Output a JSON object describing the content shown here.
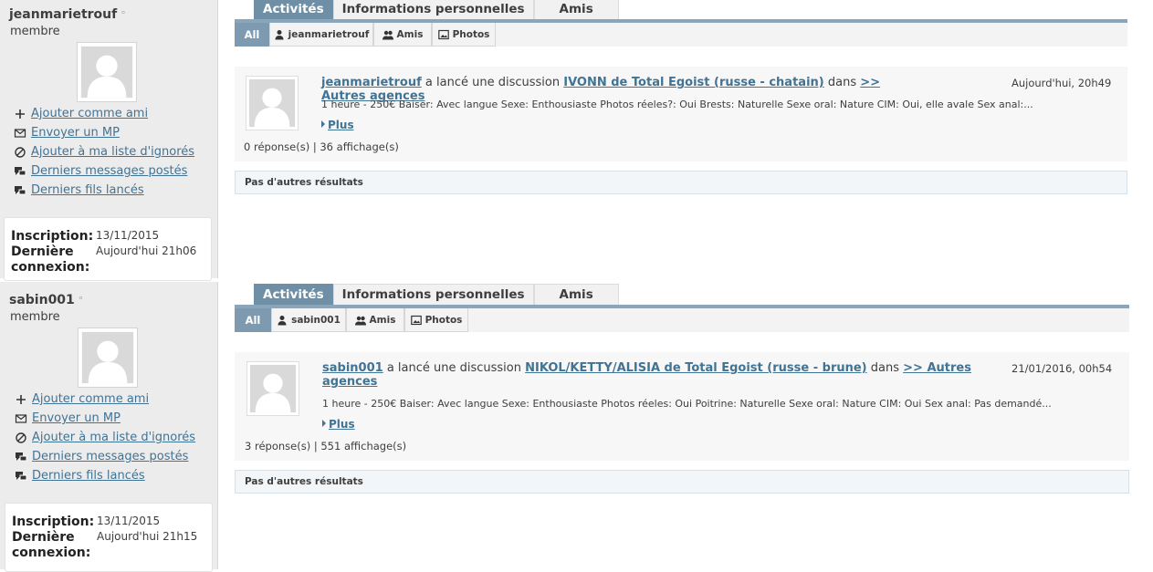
{
  "profiles": [
    {
      "username": "jeanmarietrouf",
      "status_dot": "°",
      "role": "membre",
      "actions": [
        {
          "icon": "plus-icon",
          "label": "Ajouter comme ami"
        },
        {
          "icon": "envelope-icon",
          "label": "Envoyer un MP"
        },
        {
          "icon": "block-icon",
          "label": "Ajouter à ma liste d'ignorés"
        },
        {
          "icon": "chat-bubbles-icon",
          "label": "Derniers messages postés"
        },
        {
          "icon": "chat-bubbles-icon",
          "label": "Derniers fils lancés"
        }
      ],
      "info": {
        "inscription_label": "Inscription:",
        "inscription_value": "13/11/2015",
        "derniere_label": "Dernière",
        "connexion_label": "connexion:",
        "derniere_value": "Aujourd'hui 21h06"
      },
      "tabs": [
        "Activités",
        "Informations personnelles",
        "Amis"
      ],
      "filters": [
        "All",
        "jeanmarietrouf",
        "Amis",
        "Photos"
      ],
      "activity": {
        "author": "jeanmarietrouf",
        "action_text": "a lancé une discussion",
        "thread_title": "IVONN de Total Egoist (russe - chatain)",
        "in_text": "dans",
        "forum": ">> Autres agences",
        "date": "Aujourd'hui, 20h49",
        "snippet": "1 heure - 250€ Baiser: Avec langue Sexe: Enthousiaste Photos réeles?: Oui Brests: Naturelle Sexe oral: Nature CIM: Oui, elle avale Sex anal:...",
        "more_label": "Plus",
        "stats": "0 réponse(s) | 36 affichage(s)"
      },
      "no_more": "Pas d'autres résultats"
    },
    {
      "username": "sabin001",
      "status_dot": "°",
      "role": "membre",
      "actions": [
        {
          "icon": "plus-icon",
          "label": "Ajouter comme ami"
        },
        {
          "icon": "envelope-icon",
          "label": "Envoyer un MP"
        },
        {
          "icon": "block-icon",
          "label": "Ajouter à ma liste d'ignorés"
        },
        {
          "icon": "chat-bubbles-icon",
          "label": "Derniers messages postés"
        },
        {
          "icon": "chat-bubbles-icon",
          "label": "Derniers fils lancés"
        }
      ],
      "info": {
        "inscription_label": "Inscription:",
        "inscription_value": "13/11/2015",
        "derniere_label": "Dernière",
        "connexion_label": "connexion:",
        "derniere_value": "Aujourd'hui 21h15"
      },
      "tabs": [
        "Activités",
        "Informations personnelles",
        "Amis"
      ],
      "filters": [
        "All",
        "sabin001",
        "Amis",
        "Photos"
      ],
      "activity": {
        "author": "sabin001",
        "action_text": "a lancé une discussion",
        "thread_title": "NIKOL/KETTY/ALISIA de Total Egoist (russe - brune)",
        "in_text": "dans",
        "forum": ">> Autres agences",
        "date": "21/01/2016, 00h54",
        "snippet": "1 heure - 250€ Baiser: Avec langue Sexe: Enthousiaste Photos réeles: Oui Poitrine: Naturelle Sexe oral: Nature CIM: Oui Sex anal: Pas demandé...",
        "more_label": "Plus",
        "stats": "3 réponse(s) | 551 affichage(s)"
      },
      "no_more": "Pas d'autres résultats"
    }
  ]
}
